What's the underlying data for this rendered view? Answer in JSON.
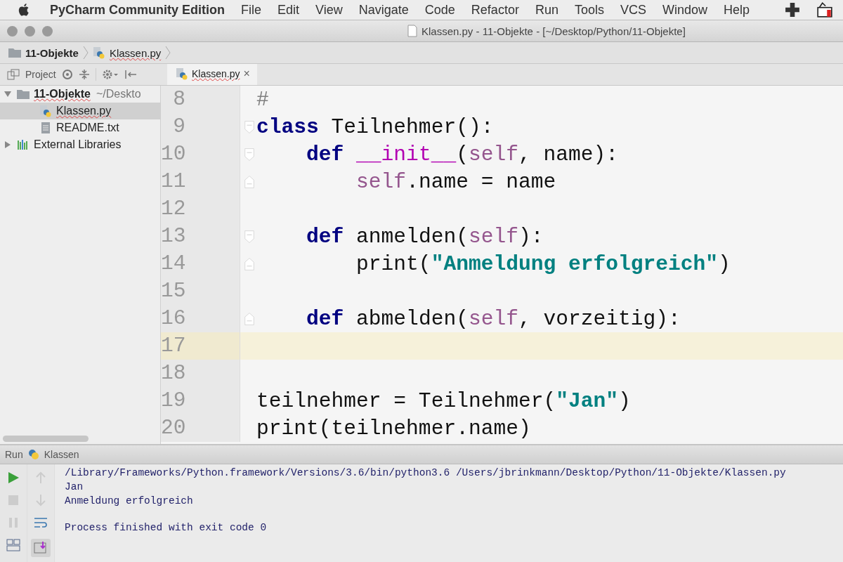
{
  "menubar": {
    "app": "PyCharm Community Edition",
    "items": [
      "File",
      "Edit",
      "View",
      "Navigate",
      "Code",
      "Refactor",
      "Run",
      "Tools",
      "VCS",
      "Window",
      "Help"
    ]
  },
  "window": {
    "title": "Klassen.py - 11-Objekte - [~/Desktop/Python/11-Objekte]"
  },
  "breadcrumbs": [
    "11-Objekte",
    "Klassen.py"
  ],
  "project_panel": {
    "label": "Project",
    "tree": [
      {
        "label": "11-Objekte",
        "hint": "~/Deskto",
        "kind": "folder",
        "expanded": true,
        "selected": false,
        "children": [
          {
            "label": "Klassen.py",
            "kind": "python",
            "selected": true
          },
          {
            "label": "README.txt",
            "kind": "text",
            "selected": false
          }
        ]
      },
      {
        "label": "External Libraries",
        "kind": "library",
        "expanded": false,
        "selected": false
      }
    ]
  },
  "tabs": [
    {
      "label": "Klassen.py",
      "close": "×",
      "selected": true
    }
  ],
  "editor": {
    "lines": [
      {
        "number": "8",
        "current": false,
        "tokens": [
          {
            "t": "#",
            "kind": "comment"
          }
        ]
      },
      {
        "number": "9",
        "current": false,
        "fold_open": true,
        "tokens": [
          {
            "t": "class",
            "kind": "keyword"
          },
          {
            "t": " Teilnehmer():",
            "kind": "plain"
          }
        ]
      },
      {
        "number": "10",
        "current": false,
        "fold_open": true,
        "tokens": [
          {
            "t": "    def",
            "kind": "keyword"
          },
          {
            "t": " __init__",
            "kind": "magic"
          },
          {
            "t": "(",
            "kind": "plain"
          },
          {
            "t": "self",
            "kind": "self"
          },
          {
            "t": ", name):",
            "kind": "plain"
          }
        ]
      },
      {
        "number": "11",
        "current": false,
        "fold_open": false,
        "tokens": [
          {
            "t": "        self",
            "kind": "self"
          },
          {
            "t": ".name = name",
            "kind": "plain"
          }
        ]
      },
      {
        "number": "12",
        "current": false
      },
      {
        "number": "13",
        "current": false,
        "fold_open": true,
        "tokens": [
          {
            "t": "    def",
            "kind": "keyword"
          },
          {
            "t": " anmelden(",
            "kind": "plain"
          },
          {
            "t": "self",
            "kind": "self"
          },
          {
            "t": "):",
            "kind": "plain"
          }
        ]
      },
      {
        "number": "14",
        "current": false,
        "fold_open": false,
        "tokens": [
          {
            "t": "        print(",
            "kind": "plain"
          },
          {
            "t": "\"Anmeldung erfolgreich\"",
            "kind": "string"
          },
          {
            "t": ")",
            "kind": "plain"
          }
        ]
      },
      {
        "number": "15",
        "current": false
      },
      {
        "number": "16",
        "current": false,
        "fold_open": false,
        "tokens": [
          {
            "t": "    def",
            "kind": "keyword"
          },
          {
            "t": " abmelden(",
            "kind": "plain"
          },
          {
            "t": "self",
            "kind": "self"
          },
          {
            "t": ", vorzeitig):",
            "kind": "plain"
          }
        ]
      },
      {
        "number": "17",
        "current": true
      },
      {
        "number": "18",
        "current": false
      },
      {
        "number": "19",
        "current": false,
        "tokens": [
          {
            "t": "teilnehmer = Teilnehmer(",
            "kind": "plain"
          },
          {
            "t": "\"Jan\"",
            "kind": "string"
          },
          {
            "t": ")",
            "kind": "plain"
          }
        ]
      },
      {
        "number": "20",
        "current": false,
        "tokens": [
          {
            "t": "print(teilnehmer.name)",
            "kind": "plain"
          }
        ]
      }
    ]
  },
  "run_panel": {
    "label": "Run",
    "config": "Klassen",
    "console": [
      {
        "text": "/Library/Frameworks/Python.framework/Versions/3.6/bin/python3.6 /Users/jbrinkmann/Desktop/Python/11-Objekte/Klassen.py",
        "kind": "output"
      },
      {
        "text": "Jan",
        "kind": "output"
      },
      {
        "text": "Anmeldung erfolgreich",
        "kind": "output"
      },
      {
        "text": "Process finished with exit code 0",
        "kind": "status"
      }
    ]
  }
}
